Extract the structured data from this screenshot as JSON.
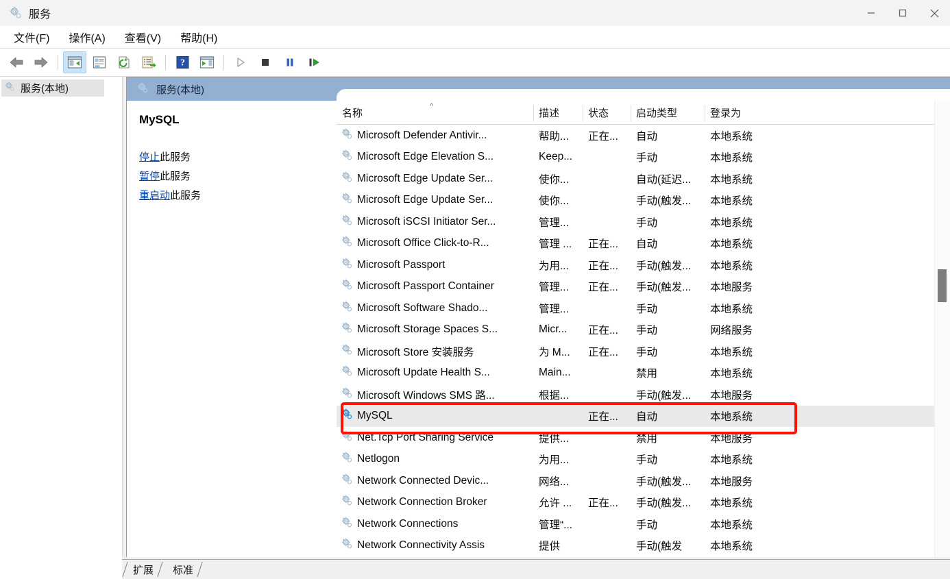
{
  "window": {
    "title": "服务",
    "icon": "services-gear-icon",
    "controls": {
      "minimize": "最小化",
      "maximize": "最大化",
      "close": "关闭"
    }
  },
  "menubar": [
    {
      "label": "文件(F)",
      "name": "menu-file"
    },
    {
      "label": "操作(A)",
      "name": "menu-action"
    },
    {
      "label": "查看(V)",
      "name": "menu-view"
    },
    {
      "label": "帮助(H)",
      "name": "menu-help"
    }
  ],
  "toolbar": [
    {
      "name": "back-arrow-icon",
      "title": "后退"
    },
    {
      "name": "forward-arrow-icon",
      "title": "前进"
    },
    {
      "name": "separator-1",
      "title": ""
    },
    {
      "name": "show-hide-tree-icon",
      "title": "显示/隐藏控制台树",
      "active": true
    },
    {
      "name": "properties-icon",
      "title": "属性"
    },
    {
      "name": "refresh-icon",
      "title": "刷新"
    },
    {
      "name": "export-list-icon",
      "title": "导出列表"
    },
    {
      "name": "separator-2",
      "title": ""
    },
    {
      "name": "help-icon",
      "title": "帮助"
    },
    {
      "name": "start-view-icon",
      "title": "显示操作窗格"
    },
    {
      "name": "separator-3",
      "title": ""
    },
    {
      "name": "start-service-icon",
      "title": "启动服务"
    },
    {
      "name": "stop-service-icon",
      "title": "停止服务"
    },
    {
      "name": "pause-service-icon",
      "title": "暂停服务"
    },
    {
      "name": "restart-service-icon",
      "title": "重启动服务"
    }
  ],
  "tree": {
    "root_label": "服务(本地)"
  },
  "detail": {
    "header_label": "服务(本地)",
    "service_name": "MySQL",
    "links": [
      {
        "link_text": "停止",
        "suffix": "此服务",
        "name": "stop-service-link"
      },
      {
        "link_text": "暂停",
        "suffix": "此服务",
        "name": "pause-service-link"
      },
      {
        "link_text": "重启动",
        "suffix": "此服务",
        "name": "restart-service-link"
      }
    ]
  },
  "list": {
    "sort_caret": "^",
    "columns": [
      {
        "key": "name",
        "label": "名称"
      },
      {
        "key": "desc",
        "label": "描述"
      },
      {
        "key": "state",
        "label": "状态"
      },
      {
        "key": "start",
        "label": "启动类型"
      },
      {
        "key": "logon",
        "label": "登录为"
      }
    ],
    "rows": [
      {
        "name": "Microsoft Defender Antivir...",
        "desc": "帮助...",
        "state": "正在...",
        "start": "自动",
        "logon": "本地系统",
        "selected": false
      },
      {
        "name": "Microsoft Edge Elevation S...",
        "desc": "Keep...",
        "state": "",
        "start": "手动",
        "logon": "本地系统",
        "selected": false
      },
      {
        "name": "Microsoft Edge Update Ser...",
        "desc": "使你...",
        "state": "",
        "start": "自动(延迟...",
        "logon": "本地系统",
        "selected": false
      },
      {
        "name": "Microsoft Edge Update Ser...",
        "desc": "使你...",
        "state": "",
        "start": "手动(触发...",
        "logon": "本地系统",
        "selected": false
      },
      {
        "name": "Microsoft iSCSI Initiator Ser...",
        "desc": "管理...",
        "state": "",
        "start": "手动",
        "logon": "本地系统",
        "selected": false
      },
      {
        "name": "Microsoft Office Click-to-R...",
        "desc": "管理 ...",
        "state": "正在...",
        "start": "自动",
        "logon": "本地系统",
        "selected": false
      },
      {
        "name": "Microsoft Passport",
        "desc": "为用...",
        "state": "正在...",
        "start": "手动(触发...",
        "logon": "本地系统",
        "selected": false
      },
      {
        "name": "Microsoft Passport Container",
        "desc": "管理...",
        "state": "正在...",
        "start": "手动(触发...",
        "logon": "本地服务",
        "selected": false
      },
      {
        "name": "Microsoft Software Shado...",
        "desc": "管理...",
        "state": "",
        "start": "手动",
        "logon": "本地系统",
        "selected": false
      },
      {
        "name": "Microsoft Storage Spaces S...",
        "desc": "Micr...",
        "state": "正在...",
        "start": "手动",
        "logon": "网络服务",
        "selected": false
      },
      {
        "name": "Microsoft Store 安装服务",
        "desc": "为 M...",
        "state": "正在...",
        "start": "手动",
        "logon": "本地系统",
        "selected": false
      },
      {
        "name": "Microsoft Update Health S...",
        "desc": "Main...",
        "state": "",
        "start": "禁用",
        "logon": "本地系统",
        "selected": false
      },
      {
        "name": "Microsoft Windows SMS 路...",
        "desc": "根据...",
        "state": "",
        "start": "手动(触发...",
        "logon": "本地服务",
        "selected": false
      },
      {
        "name": "MySQL",
        "desc": "",
        "state": "正在...",
        "start": "自动",
        "logon": "本地系统",
        "selected": true
      },
      {
        "name": "Net.Tcp Port Sharing Service",
        "desc": "提供...",
        "state": "",
        "start": "禁用",
        "logon": "本地服务",
        "selected": false
      },
      {
        "name": "Netlogon",
        "desc": "为用...",
        "state": "",
        "start": "手动",
        "logon": "本地系统",
        "selected": false
      },
      {
        "name": "Network Connected Devic...",
        "desc": "网络...",
        "state": "",
        "start": "手动(触发...",
        "logon": "本地服务",
        "selected": false
      },
      {
        "name": "Network Connection Broker",
        "desc": "允许 ...",
        "state": "正在...",
        "start": "手动(触发...",
        "logon": "本地系统",
        "selected": false
      },
      {
        "name": "Network Connections",
        "desc": "管理“...",
        "state": "",
        "start": "手动",
        "logon": "本地系统",
        "selected": false
      },
      {
        "name": "Network Connectivity Assis",
        "desc": "提供",
        "state": "",
        "start": "手动(触发",
        "logon": "本地系统",
        "selected": false
      }
    ]
  },
  "tabs": [
    {
      "label": "扩展",
      "name": "tab-extended",
      "active": false
    },
    {
      "label": "标准",
      "name": "tab-standard",
      "active": true
    }
  ],
  "annotation": {
    "color": "#fb1405",
    "target_row": "MySQL"
  }
}
